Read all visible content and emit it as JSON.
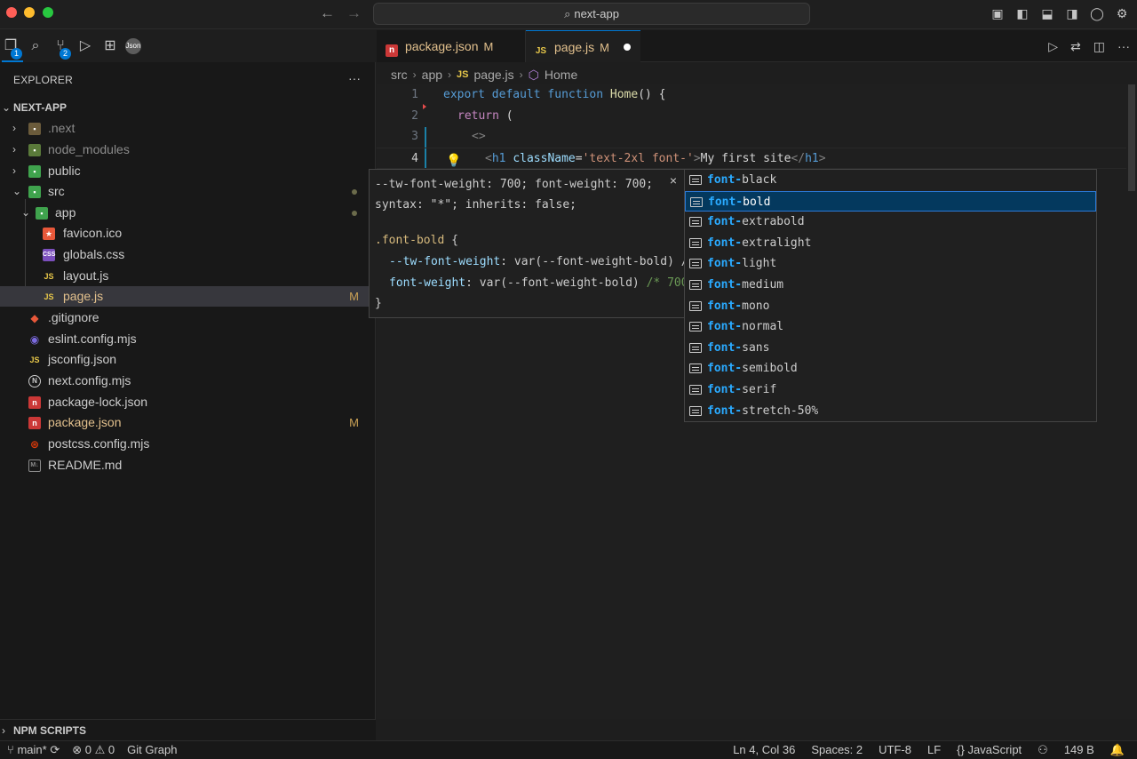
{
  "window": {
    "search_text": "next-app",
    "back_label": "←",
    "forward_label": "→"
  },
  "activity_bar": {
    "explorer_badge": "1",
    "source_control_badge": "2"
  },
  "sidebar": {
    "title": "EXPLORER",
    "more": "···",
    "project": "NEXT-APP",
    "items": [
      {
        "label": ".next"
      },
      {
        "label": "node_modules"
      },
      {
        "label": "public"
      },
      {
        "label": "src"
      },
      {
        "label": "app"
      },
      {
        "label": "favicon.ico"
      },
      {
        "label": "globals.css"
      },
      {
        "label": "layout.js"
      },
      {
        "label": "page.js",
        "status": "M"
      },
      {
        "label": ".gitignore"
      },
      {
        "label": "eslint.config.mjs"
      },
      {
        "label": "jsconfig.json"
      },
      {
        "label": "next.config.mjs"
      },
      {
        "label": "package-lock.json"
      },
      {
        "label": "package.json",
        "status": "M"
      },
      {
        "label": "postcss.config.mjs"
      },
      {
        "label": "README.md"
      }
    ],
    "npm_scripts": "NPM SCRIPTS"
  },
  "tabs": [
    {
      "label": "package.json",
      "status": "M"
    },
    {
      "label": "page.js",
      "status": "M"
    }
  ],
  "breadcrumb": {
    "src": "src",
    "app": "app",
    "file": "page.js",
    "symbol": "Home"
  },
  "editor": {
    "line_numbers": [
      "1",
      "2",
      "3",
      "4"
    ],
    "line1": {
      "export": "export",
      "default": "default",
      "function": "function",
      "name": "Home",
      "rest": "() {"
    },
    "line2": {
      "return": "return",
      "rest": " ("
    },
    "line3": {
      "frag": "<>"
    },
    "line4": {
      "open": "<",
      "tag": "h1",
      "attr": "className",
      "eq": "=",
      "str": "'text-2xl font-'",
      "close": ">",
      "text": "My first site",
      "end_open": "</",
      "end_tag": "h1",
      "end_close": ">"
    }
  },
  "hover_doc": {
    "line1": "--tw-font-weight: 700; font-weight: 700;",
    "line2": "syntax: \"*\"; inherits: false;",
    "selector": ".font-bold",
    "brace_open": " {",
    "prop1": "--tw-font-weight",
    "prop1_val": ": var(--font-weight-bold) /",
    "prop2": "font-weight",
    "prop2_val": ": var(--font-weight-bold) ",
    "prop2_comment": "/* 700",
    "brace_close": "}",
    "close": "×"
  },
  "suggestions": {
    "prefix": "font-",
    "items": [
      {
        "rest": "black"
      },
      {
        "rest": "bold"
      },
      {
        "rest": "extrabold"
      },
      {
        "rest": "extralight"
      },
      {
        "rest": "light"
      },
      {
        "rest": "medium"
      },
      {
        "rest": "mono"
      },
      {
        "rest": "normal"
      },
      {
        "rest": "sans"
      },
      {
        "rest": "semibold"
      },
      {
        "rest": "serif"
      },
      {
        "rest": "stretch-50%"
      }
    ],
    "active_index": 1
  },
  "statusbar": {
    "branch": "main*",
    "errors": "0",
    "warnings": "0",
    "git_graph": "Git Graph",
    "position": "Ln 4, Col 36",
    "spaces": "Spaces: 2",
    "encoding": "UTF-8",
    "eol": "LF",
    "language": "JavaScript",
    "size": "149 B"
  },
  "colors": {
    "accent": "#0078d4",
    "modified": "#e2c08d",
    "match": "#2aaaff"
  }
}
